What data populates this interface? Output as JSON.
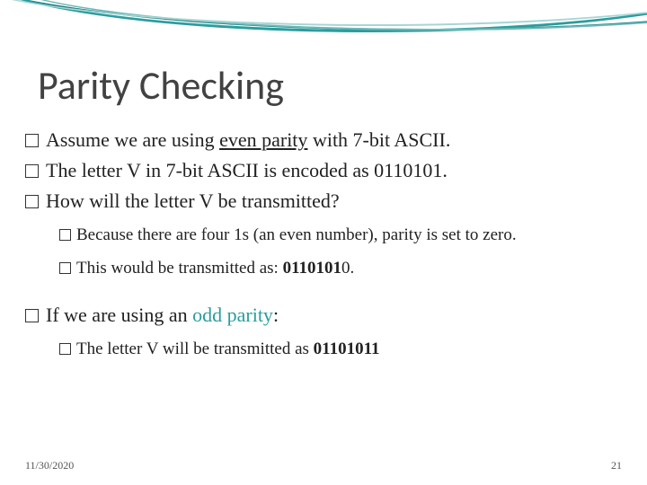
{
  "title": "Parity Checking",
  "bullets": {
    "0": {
      "a": "Assume we are using ",
      "b": "even parity",
      "c": " with 7-bit ASCII."
    },
    "1": "The letter V in 7-bit ASCII is encoded as 0110101.",
    "2": "How will the letter V be transmitted?",
    "3": {
      "a": "If we are using an ",
      "b": "odd parity",
      "c": ":"
    }
  },
  "subs": {
    "0": "Because there are four 1s (an even number), parity is set to zero.",
    "1": {
      "a": "This would be transmitted as: ",
      "b": "0110101",
      "c": "0."
    },
    "2": {
      "a": "The letter V will be transmitted as ",
      "b": "01101011"
    }
  },
  "date": "11/30/2020",
  "page": "21"
}
